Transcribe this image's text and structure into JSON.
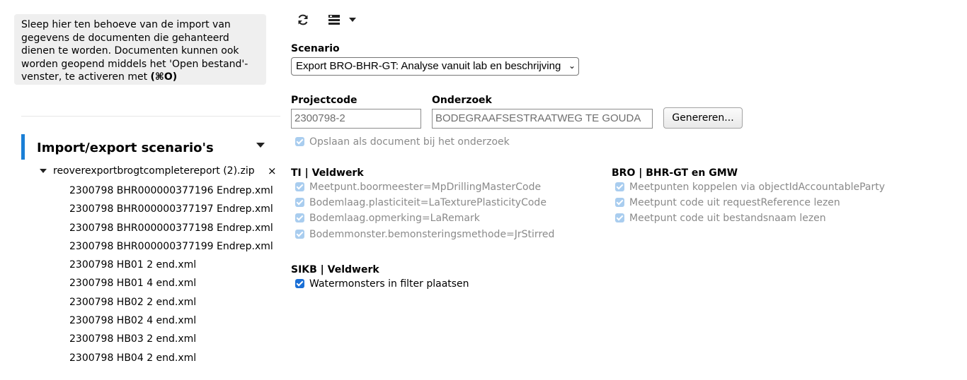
{
  "sidebar": {
    "hint_text": "Sleep hier ten behoeve van de import van gegevens de documenten die gehanteerd dienen te worden. Documenten kunnen ook worden geopend middels het 'Open bestand'-venster, te activeren met",
    "hint_shortcut": "(⌘O)",
    "section_title": "Import/export scenario's",
    "zip_name": "reoverexportbrogtcompletereport (2).zip",
    "zip_close": "×",
    "files": [
      "2300798 BHR000000377196 Endrep.xml",
      "2300798 BHR000000377197 Endrep.xml",
      "2300798 BHR000000377198 Endrep.xml",
      "2300798 BHR000000377199 Endrep.xml",
      "2300798 HB01 2 end.xml",
      "2300798 HB01 4 end.xml",
      "2300798 HB02 2 end.xml",
      "2300798 HB02 4 end.xml",
      "2300798 HB03 2 end.xml",
      "2300798 HB04 2 end.xml"
    ]
  },
  "toolbar": {
    "refresh_icon": "refresh-icon",
    "layout_icon": "layout-list-icon"
  },
  "scenario": {
    "label": "Scenario",
    "selected": "Export BRO-BHR-GT: Analyse vanuit lab en beschrijving"
  },
  "project": {
    "projectcode_label": "Projectcode",
    "projectcode_value": "2300798-2",
    "onderzoek_label": "Onderzoek",
    "onderzoek_value": "BODEGRAAFSESTRAATWEG TE GOUDA",
    "generate_button": "Genereren...",
    "save_as_document": "Opslaan als document bij het onderzoek"
  },
  "groups": {
    "ti": {
      "title": "TI | Veldwerk",
      "options": [
        "Meetpunt.boormeester=MpDrillingMasterCode",
        "Bodemlaag.plasticiteit=LaTexturePlasticityCode",
        "Bodemlaag.opmerking=LaRemark",
        "Bodemmonster.bemonsteringsmethode=JrStirred"
      ]
    },
    "bro": {
      "title": "BRO | BHR-GT en GMW",
      "options": [
        "Meetpunten koppelen via objectIdAccountableParty",
        "Meetpunt code uit requestReference lezen",
        "Meetpunt code uit bestandsnaam lezen"
      ]
    },
    "sikb": {
      "title": "SIKB | Veldwerk",
      "options": [
        "Watermonsters in filter plaatsen"
      ]
    }
  },
  "colors": {
    "accent": "#1a7fd6",
    "checkbox_disabled": "#a9cdef",
    "checkbox_active": "#1a6fd6"
  }
}
